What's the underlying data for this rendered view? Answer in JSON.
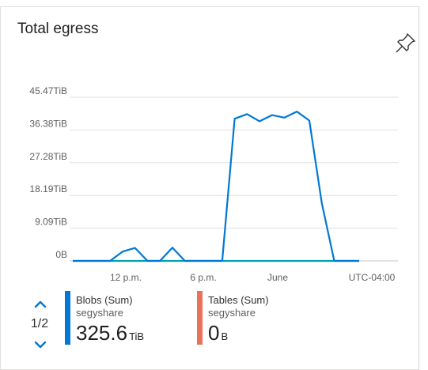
{
  "tile": {
    "title": "Total egress",
    "pin_icon": "pin-icon"
  },
  "chart_data": {
    "type": "line",
    "y_ticks": [
      "0B",
      "9.09TiB",
      "18.19TiB",
      "27.28TiB",
      "36.38TiB",
      "45.47TiB"
    ],
    "y_tick_values": [
      0,
      9.09,
      18.19,
      27.28,
      36.38,
      45.47
    ],
    "ylim": [
      0,
      45.47
    ],
    "x_ticks": [
      "12 p.m.",
      "6 p.m.",
      "June"
    ],
    "timezone": "UTC-04:00",
    "grid": true,
    "series": [
      {
        "name": "Blobs (Sum)",
        "color": "#0078d4",
        "values": [
          0,
          0,
          0,
          0,
          2.6,
          3.6,
          0,
          0,
          3.7,
          0,
          0,
          0,
          0,
          39.5,
          40.8,
          38.8,
          40.5,
          39.8,
          41.5,
          39.0,
          16.0,
          0,
          0,
          0
        ]
      },
      {
        "name": "Tables (Sum)",
        "color": "#e8735a",
        "values": [
          0,
          0,
          0,
          0,
          0,
          0,
          0,
          0,
          0,
          0,
          0,
          0,
          0,
          0,
          0,
          0,
          0,
          0,
          0,
          0,
          0,
          0,
          0,
          0
        ]
      }
    ]
  },
  "pager": {
    "label": "1/2",
    "up_icon": "chevron-up-icon",
    "down_icon": "chevron-down-icon"
  },
  "legend": [
    {
      "name": "Blobs (Sum)",
      "resource": "segyshare",
      "value": "325.6",
      "unit": "TiB",
      "color": "#0078d4"
    },
    {
      "name": "Tables (Sum)",
      "resource": "segyshare",
      "value": "0",
      "unit": "B",
      "color": "#e8735a"
    }
  ]
}
